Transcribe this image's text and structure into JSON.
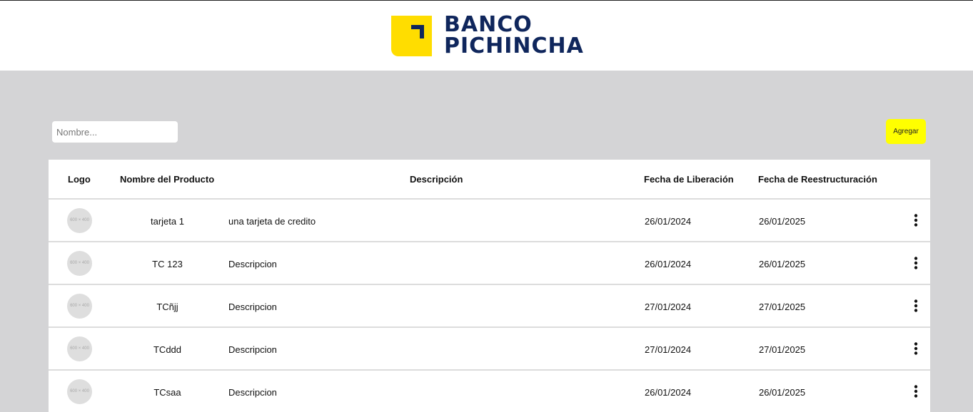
{
  "brand": {
    "line1": "BANCO",
    "line2": "PICHINCHA",
    "colors": {
      "yellow": "#ffdd00",
      "navy": "#0f265c"
    }
  },
  "search": {
    "placeholder": "Nombre...",
    "value": ""
  },
  "toolbar": {
    "add_label": "Agregar",
    "add_color": "#ffff00"
  },
  "table": {
    "headers": [
      "Logo",
      "Nombre del Producto",
      "Descripción",
      "Fecha de Liberación",
      "Fecha de Reestructuración"
    ],
    "rows": [
      {
        "logo_text": "600 × 400",
        "name": "tarjeta 1",
        "description": "una tarjeta de credito",
        "release": "26/01/2024",
        "revision": "26/01/2025",
        "menu_icon": "kebab-menu-icon"
      },
      {
        "logo_text": "600 × 400",
        "name": "TC 123",
        "description": "Descripcion",
        "release": "26/01/2024",
        "revision": "26/01/2025",
        "menu_icon": "kebab-menu-icon"
      },
      {
        "logo_text": "600 × 400",
        "name": "TCñjj",
        "description": "Descripcion",
        "release": "27/01/2024",
        "revision": "27/01/2025",
        "menu_icon": "kebab-menu-icon"
      },
      {
        "logo_text": "600 × 400",
        "name": "TCddd",
        "description": "Descripcion",
        "release": "27/01/2024",
        "revision": "27/01/2025",
        "menu_icon": "kebab-menu-icon"
      },
      {
        "logo_text": "600 × 400",
        "name": "TCsaa",
        "description": "Descripcion",
        "release": "26/01/2024",
        "revision": "26/01/2025",
        "menu_icon": "kebab-menu-icon"
      }
    ]
  }
}
